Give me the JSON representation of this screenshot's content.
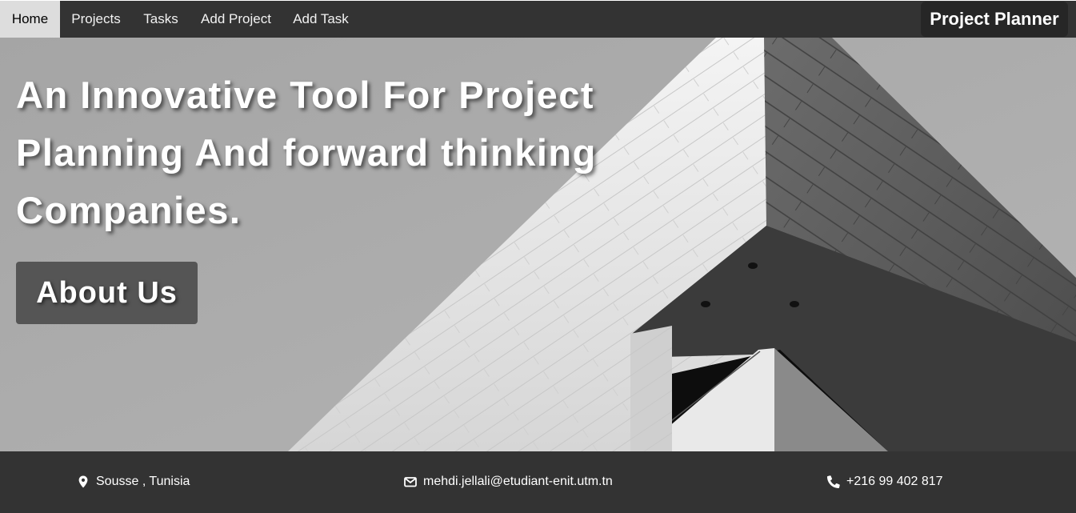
{
  "nav": {
    "items": [
      {
        "label": "Home",
        "active": true
      },
      {
        "label": "Projects",
        "active": false
      },
      {
        "label": "Tasks",
        "active": false
      },
      {
        "label": "Add Project",
        "active": false
      },
      {
        "label": "Add Task",
        "active": false
      }
    ],
    "brand": "Project Planner"
  },
  "hero": {
    "headline_lines": [
      "An Innovative Tool For Project",
      "Planning And forward thinking",
      "Companies."
    ],
    "button_label": "About Us",
    "background_image": "grayscale-building-corner-photo"
  },
  "footer": {
    "location": {
      "icon": "map-pin-icon",
      "text": "Sousse , Tunisia"
    },
    "email": {
      "icon": "envelope-icon",
      "text": "mehdi.jellali@etudiant-enit.utm.tn"
    },
    "phone": {
      "icon": "phone-icon",
      "text": "+216 99 402 817"
    }
  },
  "colors": {
    "nav_bg": "#333333",
    "nav_active_bg": "#dddddd",
    "brand_bg": "#262626",
    "button_bg": "#555555",
    "footer_bg": "#333333"
  }
}
